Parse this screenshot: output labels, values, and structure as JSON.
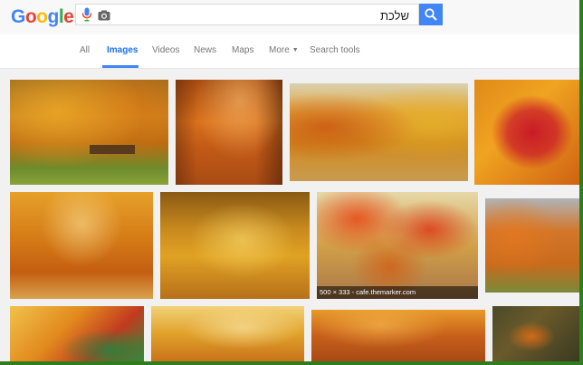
{
  "logo": {
    "text": "Google"
  },
  "search": {
    "query": "שלכת"
  },
  "icons": {
    "mic": "mic-icon",
    "camera": "camera-icon",
    "search": "search-icon"
  },
  "tabs": [
    {
      "label": "All"
    },
    {
      "label": "Images",
      "active": true
    },
    {
      "label": "Videos"
    },
    {
      "label": "News"
    },
    {
      "label": "Maps"
    },
    {
      "label": "More"
    },
    {
      "label": "Search tools"
    }
  ],
  "results": {
    "hover_caption": "500 × 333 - cafe.themarker.com"
  },
  "colors": {
    "accent": "#4285f4",
    "border": "#2f7d1f"
  }
}
